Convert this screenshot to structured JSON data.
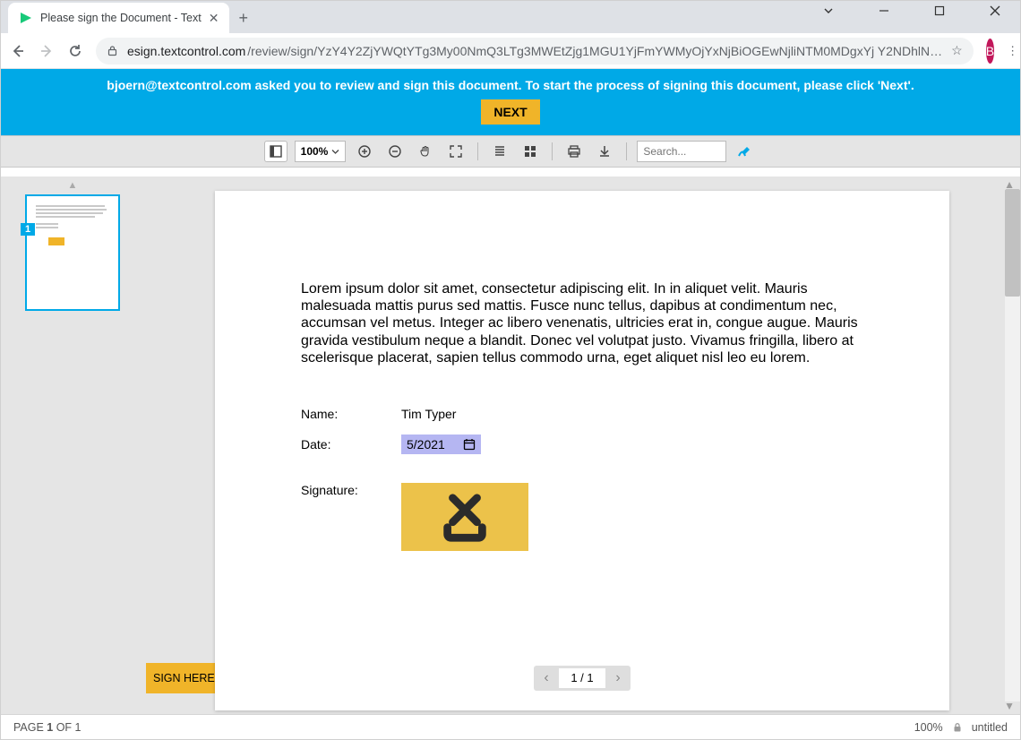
{
  "browser": {
    "tab_title": "Please sign the Document - Text",
    "url_host": "esign.textcontrol.com",
    "url_path": "/review/sign/YzY4Y2ZjYWQtYTg3My00NmQ3LTg3MWEtZjg1MGU1YjFmYWMyOjYxNjBiOGEwNjliNTM0MDgxYj Y2NDhlN…",
    "profile_initial": "B"
  },
  "banner": {
    "message": "bjoern@textcontrol.com asked you to review and sign this document. To start the process of signing this document, please click 'Next'.",
    "button": "NEXT"
  },
  "toolbar": {
    "zoom": "100%",
    "search_placeholder": "Search..."
  },
  "thumbnail": {
    "page_number": "1"
  },
  "document": {
    "body_text": "Lorem ipsum dolor sit amet, consectetur adipiscing elit. In in aliquet velit. Mauris malesuada mattis purus sed mattis. Fusce nunc tellus, dapibus at condimentum nec, accumsan vel metus. Integer ac libero venenatis, ultricies erat in, congue augue. Mauris gravida vestibulum neque a blandit. Donec vel volutpat justo. Vivamus fringilla, libero at scelerisque placerat, sapien tellus commodo urna, eget aliquet nisl leo eu lorem.",
    "name_label": "Name:",
    "name_value": "Tim Typer",
    "date_label": "Date:",
    "date_value": "5/2021",
    "signature_label": "Signature:",
    "sign_here": "SIGN HERE"
  },
  "pager": {
    "display": "1 / 1"
  },
  "status": {
    "page_text_prefix": "PAGE ",
    "page_text_bold": "1",
    "page_text_suffix": " OF 1",
    "zoom": "100%",
    "filename": "untitled"
  }
}
